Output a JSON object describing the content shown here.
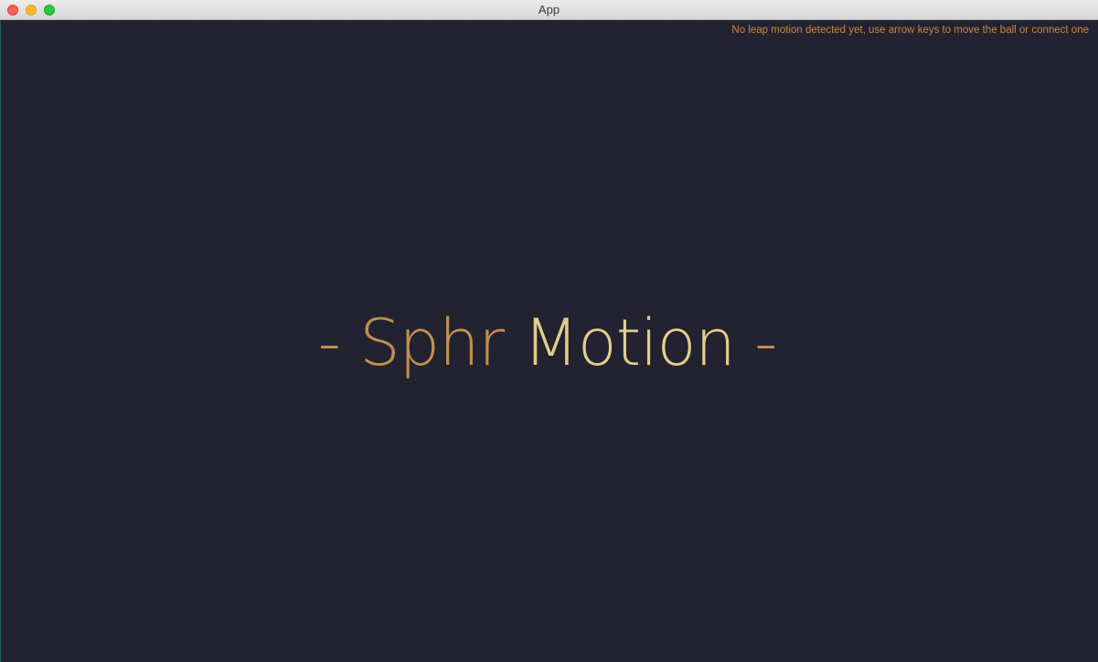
{
  "window": {
    "title": "App",
    "controls": [
      "close",
      "minimize",
      "zoom"
    ]
  },
  "status": {
    "notice": "No leap motion detected yet, use arrow keys to move the ball or connect one"
  },
  "headline": {
    "dash_left": "-",
    "word1": "Sphr",
    "word2": "Motion",
    "dash_right": "-"
  },
  "colors": {
    "background": "#232230",
    "accent_orange": "#c08f4f",
    "accent_gold": "#e4cd8a",
    "notice": "#c7893f"
  }
}
